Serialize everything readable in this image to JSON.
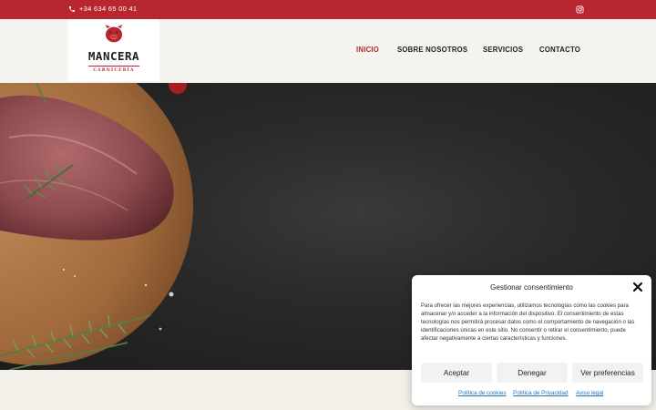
{
  "topbar": {
    "phone": "+34 634 65 00 41",
    "phone_icon": "phone-icon",
    "social_icon": "instagram-icon",
    "bg_color": "#b8272f"
  },
  "header": {
    "logo": {
      "name": "MANCERA",
      "subtitle": "CARNICERÍA",
      "icon": "pig-icon"
    },
    "nav": [
      {
        "label": "INICIO",
        "active": true
      },
      {
        "label": "SOBRE NOSOTROS",
        "active": false
      },
      {
        "label": "SERVICIOS",
        "active": false
      },
      {
        "label": "CONTACTO",
        "active": false
      }
    ]
  },
  "cookie": {
    "title": "Gestionar consentimiento",
    "close_icon": "close-icon",
    "text": "Para ofrecer las mejores experiencias, utilizamos tecnologías como las cookies para almacenar y/o acceder a la información del dispositivo. El consentimiento de estas tecnologías nos permitirá procesar datos como el comportamiento de navegación o las identificaciones únicas en este sitio. No consentir o retirar el consentimiento, puede afectar negativamente a ciertas características y funciones.",
    "buttons": {
      "accept": "Aceptar",
      "deny": "Denegar",
      "preferences": "Ver preferencias"
    },
    "links": {
      "cookies": "Política de cookies",
      "privacy": "Política de Privacidad",
      "legal": "Aviso legal"
    }
  },
  "colors": {
    "accent": "#b8272f",
    "link": "#1e73be"
  }
}
